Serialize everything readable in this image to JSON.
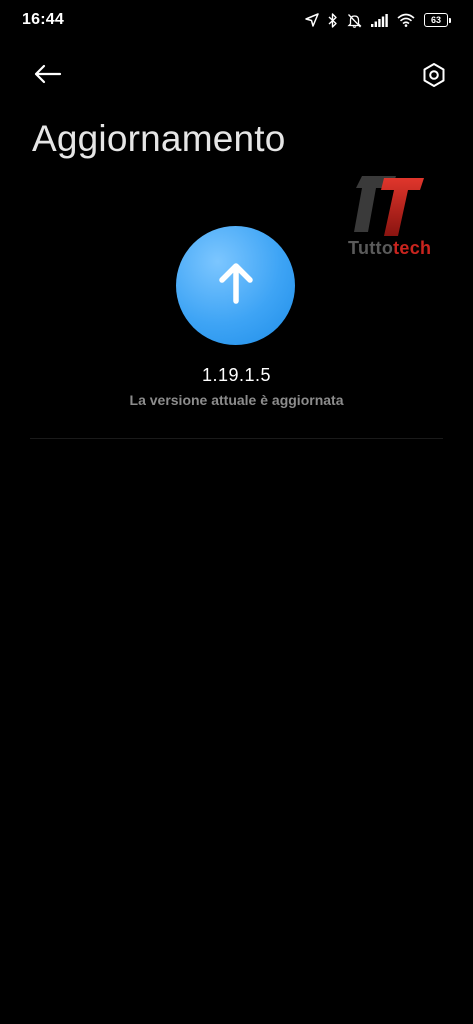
{
  "status_bar": {
    "time": "16:44",
    "battery_level": "63",
    "icons": [
      "location-arrow-icon",
      "bluetooth-icon",
      "bell-muted-icon",
      "signal-icon",
      "wifi-icon",
      "battery-icon"
    ]
  },
  "header": {
    "back_icon": "arrow-left-icon",
    "settings_icon": "settings-hexagon-icon",
    "title": "Aggiornamento"
  },
  "watermark": {
    "text_part1": "Tutto",
    "text_part2": "tech",
    "colors": {
      "dark": "#5a5a5a",
      "red": "#c9241e"
    }
  },
  "update": {
    "icon": "arrow-up-icon",
    "version": "1.19.1.5",
    "status": "La versione attuale è aggiornata",
    "accent_color": "#3ea4f5"
  }
}
